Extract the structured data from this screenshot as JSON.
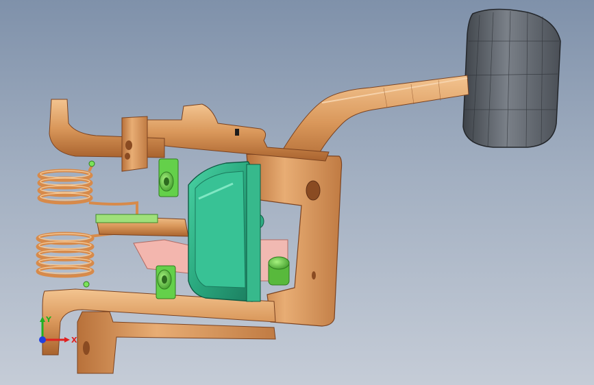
{
  "viewport": {
    "background_top": "#7f91aa",
    "background_bottom": "#c5ccd7"
  },
  "model": {
    "colors": {
      "bronze": "#d9975a",
      "bronze_dark": "#9c5a2a",
      "bronze_light": "#f1c08e",
      "green": "#2fb58a",
      "green_dark": "#177a5c",
      "lime": "#7be35a",
      "pad": "#5b6068",
      "pink": "#f2b3ad"
    }
  },
  "triad": {
    "x_label": "X",
    "y_label": "Y",
    "x_color": "#e02020",
    "y_color": "#22b022",
    "z_color": "#2040e0"
  }
}
